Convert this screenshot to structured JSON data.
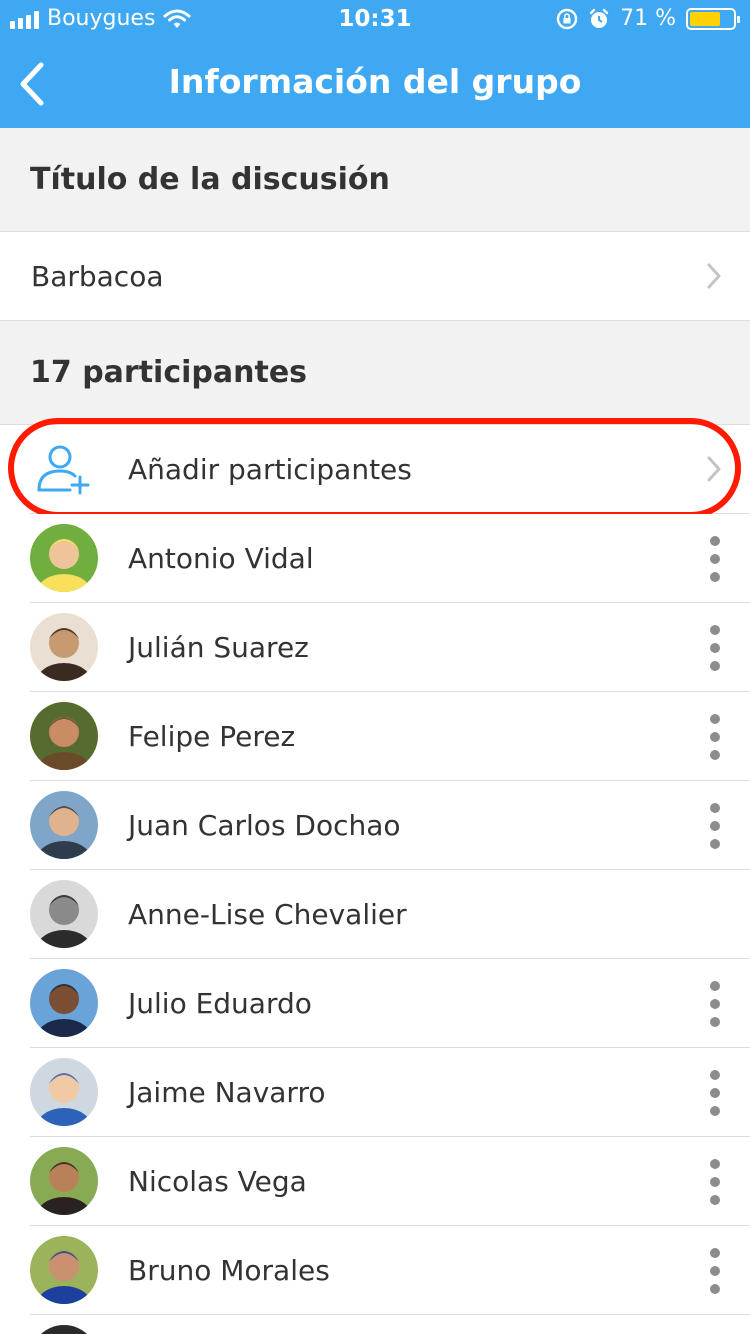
{
  "status_bar": {
    "carrier": "Bouygues",
    "time": "10:31",
    "battery_percent": "71 %",
    "battery_level": 0.71,
    "icons": [
      "signal-icon",
      "wifi-icon",
      "rotation-lock-icon",
      "alarm-icon",
      "battery-icon"
    ]
  },
  "header": {
    "title": "Información del grupo",
    "back_icon": "chevron-left-icon"
  },
  "discussion": {
    "section_title": "Título de la discusión",
    "name": "Barbacoa"
  },
  "participants": {
    "section_title": "17 participantes",
    "add_label": "Añadir participantes",
    "add_icon": "add-user-icon",
    "list": [
      {
        "name": "Antonio Vidal",
        "menu": true
      },
      {
        "name": "Julián Suarez",
        "menu": true
      },
      {
        "name": "Felipe Perez",
        "menu": true
      },
      {
        "name": "Juan Carlos Dochao",
        "menu": true
      },
      {
        "name": "Anne-Lise Chevalier",
        "menu": false
      },
      {
        "name": "Julio Eduardo",
        "menu": true
      },
      {
        "name": "Jaime Navarro",
        "menu": true
      },
      {
        "name": "Nicolas Vega",
        "menu": true
      },
      {
        "name": "Bruno Morales",
        "menu": true
      }
    ]
  },
  "colors": {
    "accent": "#3ea8f2",
    "highlight": "#ff1a00",
    "battery": "#ffd200"
  }
}
